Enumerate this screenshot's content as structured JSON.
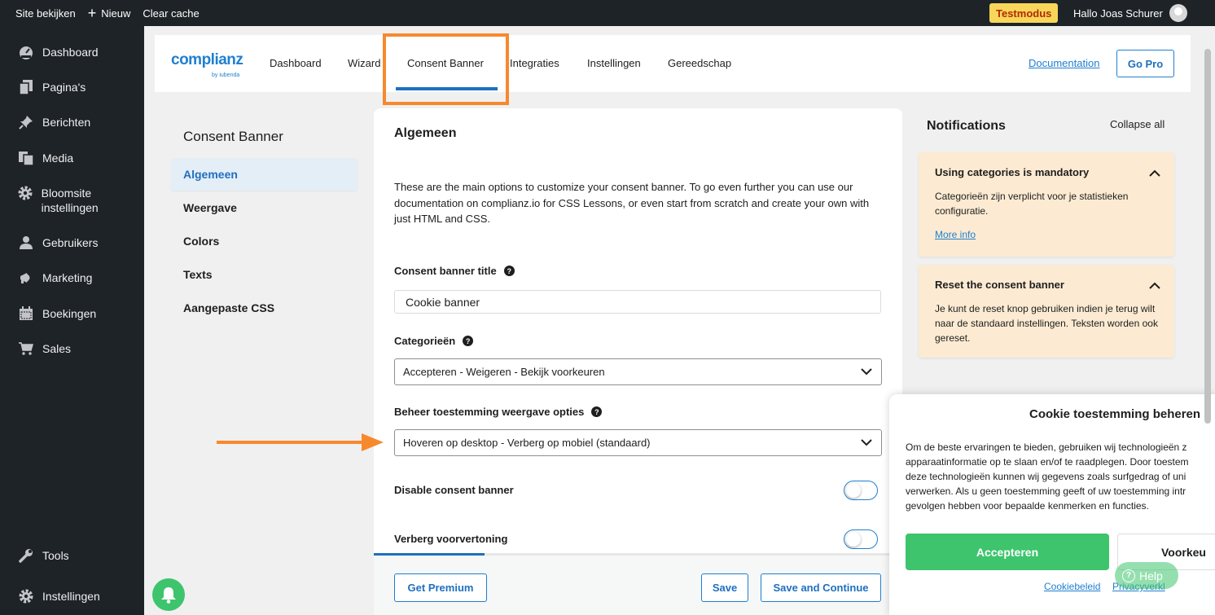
{
  "adminbar": {
    "site_view": "Site bekijken",
    "new": "Nieuw",
    "clear_cache": "Clear cache",
    "test_mode": "Testmodus",
    "greeting": "Hallo Joas Schurer"
  },
  "sidebar": {
    "items": [
      {
        "label": "Dashboard",
        "icon": "dashboard-icon"
      },
      {
        "label": "Pagina's",
        "icon": "pages-icon"
      },
      {
        "label": "Berichten",
        "icon": "pin-icon"
      },
      {
        "label": "Media",
        "icon": "media-icon"
      },
      {
        "label": "Bloomsite instellingen",
        "icon": "gear-icon"
      },
      {
        "label": "Gebruikers",
        "icon": "user-icon"
      },
      {
        "label": "Marketing",
        "icon": "megaphone-icon"
      },
      {
        "label": "Boekingen",
        "icon": "calendar-icon"
      },
      {
        "label": "Sales",
        "icon": "cart-icon"
      },
      {
        "label": "Tools",
        "icon": "wrench-icon"
      },
      {
        "label": "Instellingen",
        "icon": "settings-icon"
      }
    ]
  },
  "topnav": {
    "logo": "complianz",
    "logo_sub": "by iubenda",
    "tabs": [
      "Dashboard",
      "Wizard",
      "Consent Banner",
      "Integraties",
      "Instellingen",
      "Gereedschap"
    ],
    "active_tab": "Consent Banner",
    "documentation": "Documentation",
    "go_pro": "Go Pro"
  },
  "subnav": {
    "title": "Consent Banner",
    "items": [
      "Algemeen",
      "Weergave",
      "Colors",
      "Texts",
      "Aangepaste CSS"
    ],
    "active": "Algemeen"
  },
  "main": {
    "title": "Algemeen",
    "description": "These are the main options to customize your consent banner. To go even further you can use our documentation on complianz.io for CSS Lessons, or even start from scratch and create your own with just HTML and CSS.",
    "fields": {
      "banner_title_label": "Consent banner title",
      "banner_title_value": "Cookie banner",
      "categories_label": "Categorieën",
      "categories_value": "Accepteren - Weigeren - Bekijk voorkeuren",
      "manage_label": "Beheer toestemming weergave opties",
      "manage_value": "Hoveren op desktop - Verberg op mobiel (standaard)",
      "disable_label": "Disable consent banner",
      "disable_on": false,
      "hide_preview_label": "Verberg voorvertoning",
      "hide_preview_on": false
    },
    "progress": 0.21,
    "footer": {
      "premium": "Get Premium",
      "save": "Save",
      "save_continue": "Save and Continue"
    }
  },
  "notifications": {
    "title": "Notifications",
    "collapse_all": "Collapse all",
    "items": [
      {
        "title": "Using categories is mandatory",
        "body": "Categorieën zijn verplicht voor je statistieken configuratie.",
        "link": "More info"
      },
      {
        "title": "Reset the consent banner",
        "body": "Je kunt de reset knop gebruiken indien je terug wilt naar de standaard instellingen. Teksten worden ook gereset."
      }
    ]
  },
  "cookie_banner": {
    "title": "Cookie toestemming beheren",
    "text_lines": [
      "Om de beste ervaringen te bieden, gebruiken wij technologieën z",
      "apparaatinformatie op te slaan en/of te raadplegen. Door toestem",
      "deze technologieën kunnen wij gegevens zoals surfgedrag of uni",
      "verwerken. Als u geen toestemming geeft of uw toestemming intr",
      "gevolgen hebben voor bepaalde kenmerken en functies."
    ],
    "accept": "Accepteren",
    "preferences": "Voorkeu",
    "cookie_policy": "Cookiebeleid",
    "privacy": "Privacyverkl",
    "help": "Help"
  },
  "colors": {
    "accent": "#1f6fbf",
    "highlight": "#f7892d",
    "accept_green": "#3ec46d",
    "notice_bg": "#fcebd2"
  }
}
